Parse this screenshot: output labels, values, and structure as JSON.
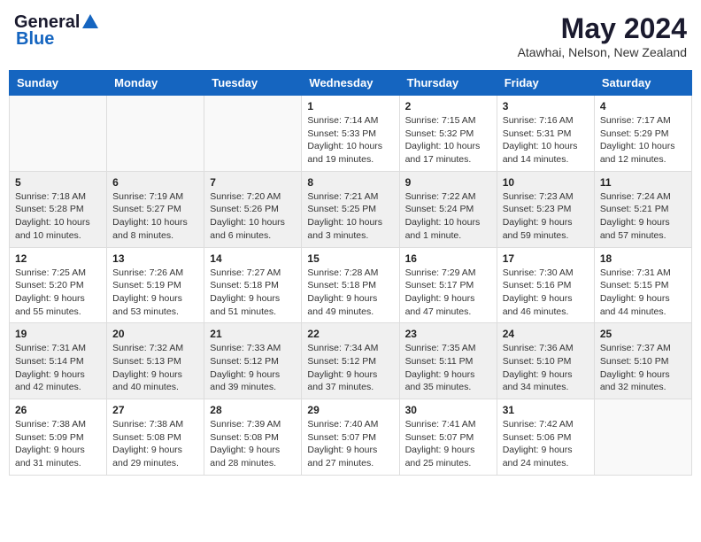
{
  "header": {
    "logo_general": "General",
    "logo_blue": "Blue",
    "month_year": "May 2024",
    "location": "Atawhai, Nelson, New Zealand"
  },
  "days_of_week": [
    "Sunday",
    "Monday",
    "Tuesday",
    "Wednesday",
    "Thursday",
    "Friday",
    "Saturday"
  ],
  "weeks": [
    [
      {
        "day": "",
        "info": ""
      },
      {
        "day": "",
        "info": ""
      },
      {
        "day": "",
        "info": ""
      },
      {
        "day": "1",
        "info": "Sunrise: 7:14 AM\nSunset: 5:33 PM\nDaylight: 10 hours\nand 19 minutes."
      },
      {
        "day": "2",
        "info": "Sunrise: 7:15 AM\nSunset: 5:32 PM\nDaylight: 10 hours\nand 17 minutes."
      },
      {
        "day": "3",
        "info": "Sunrise: 7:16 AM\nSunset: 5:31 PM\nDaylight: 10 hours\nand 14 minutes."
      },
      {
        "day": "4",
        "info": "Sunrise: 7:17 AM\nSunset: 5:29 PM\nDaylight: 10 hours\nand 12 minutes."
      }
    ],
    [
      {
        "day": "5",
        "info": "Sunrise: 7:18 AM\nSunset: 5:28 PM\nDaylight: 10 hours\nand 10 minutes."
      },
      {
        "day": "6",
        "info": "Sunrise: 7:19 AM\nSunset: 5:27 PM\nDaylight: 10 hours\nand 8 minutes."
      },
      {
        "day": "7",
        "info": "Sunrise: 7:20 AM\nSunset: 5:26 PM\nDaylight: 10 hours\nand 6 minutes."
      },
      {
        "day": "8",
        "info": "Sunrise: 7:21 AM\nSunset: 5:25 PM\nDaylight: 10 hours\nand 3 minutes."
      },
      {
        "day": "9",
        "info": "Sunrise: 7:22 AM\nSunset: 5:24 PM\nDaylight: 10 hours\nand 1 minute."
      },
      {
        "day": "10",
        "info": "Sunrise: 7:23 AM\nSunset: 5:23 PM\nDaylight: 9 hours\nand 59 minutes."
      },
      {
        "day": "11",
        "info": "Sunrise: 7:24 AM\nSunset: 5:21 PM\nDaylight: 9 hours\nand 57 minutes."
      }
    ],
    [
      {
        "day": "12",
        "info": "Sunrise: 7:25 AM\nSunset: 5:20 PM\nDaylight: 9 hours\nand 55 minutes."
      },
      {
        "day": "13",
        "info": "Sunrise: 7:26 AM\nSunset: 5:19 PM\nDaylight: 9 hours\nand 53 minutes."
      },
      {
        "day": "14",
        "info": "Sunrise: 7:27 AM\nSunset: 5:18 PM\nDaylight: 9 hours\nand 51 minutes."
      },
      {
        "day": "15",
        "info": "Sunrise: 7:28 AM\nSunset: 5:18 PM\nDaylight: 9 hours\nand 49 minutes."
      },
      {
        "day": "16",
        "info": "Sunrise: 7:29 AM\nSunset: 5:17 PM\nDaylight: 9 hours\nand 47 minutes."
      },
      {
        "day": "17",
        "info": "Sunrise: 7:30 AM\nSunset: 5:16 PM\nDaylight: 9 hours\nand 46 minutes."
      },
      {
        "day": "18",
        "info": "Sunrise: 7:31 AM\nSunset: 5:15 PM\nDaylight: 9 hours\nand 44 minutes."
      }
    ],
    [
      {
        "day": "19",
        "info": "Sunrise: 7:31 AM\nSunset: 5:14 PM\nDaylight: 9 hours\nand 42 minutes."
      },
      {
        "day": "20",
        "info": "Sunrise: 7:32 AM\nSunset: 5:13 PM\nDaylight: 9 hours\nand 40 minutes."
      },
      {
        "day": "21",
        "info": "Sunrise: 7:33 AM\nSunset: 5:12 PM\nDaylight: 9 hours\nand 39 minutes."
      },
      {
        "day": "22",
        "info": "Sunrise: 7:34 AM\nSunset: 5:12 PM\nDaylight: 9 hours\nand 37 minutes."
      },
      {
        "day": "23",
        "info": "Sunrise: 7:35 AM\nSunset: 5:11 PM\nDaylight: 9 hours\nand 35 minutes."
      },
      {
        "day": "24",
        "info": "Sunrise: 7:36 AM\nSunset: 5:10 PM\nDaylight: 9 hours\nand 34 minutes."
      },
      {
        "day": "25",
        "info": "Sunrise: 7:37 AM\nSunset: 5:10 PM\nDaylight: 9 hours\nand 32 minutes."
      }
    ],
    [
      {
        "day": "26",
        "info": "Sunrise: 7:38 AM\nSunset: 5:09 PM\nDaylight: 9 hours\nand 31 minutes."
      },
      {
        "day": "27",
        "info": "Sunrise: 7:38 AM\nSunset: 5:08 PM\nDaylight: 9 hours\nand 29 minutes."
      },
      {
        "day": "28",
        "info": "Sunrise: 7:39 AM\nSunset: 5:08 PM\nDaylight: 9 hours\nand 28 minutes."
      },
      {
        "day": "29",
        "info": "Sunrise: 7:40 AM\nSunset: 5:07 PM\nDaylight: 9 hours\nand 27 minutes."
      },
      {
        "day": "30",
        "info": "Sunrise: 7:41 AM\nSunset: 5:07 PM\nDaylight: 9 hours\nand 25 minutes."
      },
      {
        "day": "31",
        "info": "Sunrise: 7:42 AM\nSunset: 5:06 PM\nDaylight: 9 hours\nand 24 minutes."
      },
      {
        "day": "",
        "info": ""
      }
    ]
  ]
}
